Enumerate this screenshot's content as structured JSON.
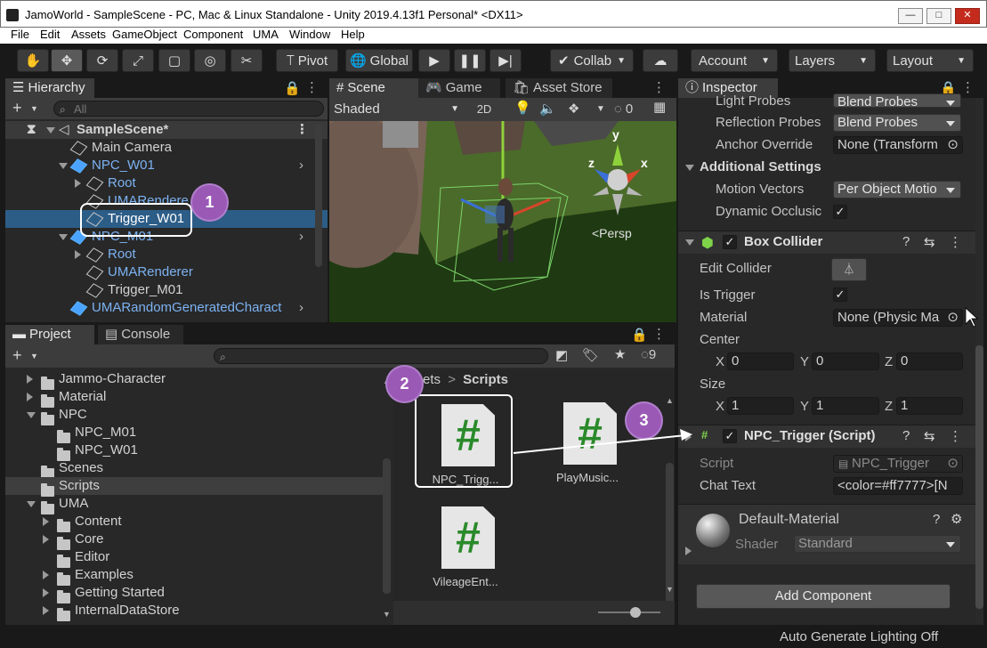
{
  "window": {
    "title": "JamoWorld - SampleScene - PC, Mac & Linux Standalone - Unity 2019.4.13f1 Personal* <DX11>",
    "controls": [
      "—",
      "□",
      "✕"
    ]
  },
  "menu": [
    "File",
    "Edit",
    "Assets",
    "GameObject",
    "Component",
    "UMA",
    "Window",
    "Help"
  ],
  "toolbar": {
    "pivot": "Pivot",
    "global": "Global",
    "collab": "Collab",
    "account": "Account",
    "layers": "Layers",
    "layout": "Layout"
  },
  "hierarchy": {
    "tab": "Hierarchy",
    "search_placeholder": "All",
    "scene": "SampleScene*",
    "items": [
      {
        "label": "Main Camera",
        "indent": 1,
        "color": "normal",
        "arrow": "none",
        "icon": "cube"
      },
      {
        "label": "NPC_W01",
        "indent": 1,
        "color": "blue",
        "arrow": "down",
        "icon": "blue-cube",
        "chevron": true
      },
      {
        "label": "Root",
        "indent": 2,
        "color": "blue",
        "arrow": "right",
        "icon": "cube"
      },
      {
        "label": "UMARendere",
        "indent": 2,
        "color": "blue",
        "arrow": "none",
        "icon": "cube"
      },
      {
        "label": "Trigger_W01",
        "indent": 2,
        "color": "normal",
        "arrow": "none",
        "icon": "cube",
        "selected": true
      },
      {
        "label": "NPC_M01",
        "indent": 1,
        "color": "blue",
        "arrow": "down",
        "icon": "blue-cube",
        "chevron": true
      },
      {
        "label": "Root",
        "indent": 2,
        "color": "blue",
        "arrow": "right",
        "icon": "cube"
      },
      {
        "label": "UMARenderer",
        "indent": 2,
        "color": "blue",
        "arrow": "none",
        "icon": "cube"
      },
      {
        "label": "Trigger_M01",
        "indent": 2,
        "color": "normal",
        "arrow": "none",
        "icon": "cube"
      },
      {
        "label": "UMARandomGeneratedCharact",
        "indent": 1,
        "color": "blue",
        "arrow": "none",
        "icon": "blue-cube",
        "chevron": true
      }
    ]
  },
  "scene": {
    "tabs": [
      "Scene",
      "Game",
      "Asset Store"
    ],
    "shading": "Shaded",
    "mode": "2D",
    "hidden_count": "0",
    "gizmo_axes": {
      "y": "y",
      "x": "x",
      "z": "z"
    },
    "persp": "<Persp"
  },
  "project": {
    "tabs": [
      "Project",
      "Console"
    ],
    "hidden_count": "9",
    "tree": [
      {
        "label": "Jammo-Character",
        "indent": 1,
        "arrow": "right"
      },
      {
        "label": "Material",
        "indent": 1,
        "arrow": "right"
      },
      {
        "label": "NPC",
        "indent": 1,
        "arrow": "down"
      },
      {
        "label": "NPC_M01",
        "indent": 2,
        "arrow": "none"
      },
      {
        "label": "NPC_W01",
        "indent": 2,
        "arrow": "none"
      },
      {
        "label": "Scenes",
        "indent": 1,
        "arrow": "none"
      },
      {
        "label": "Scripts",
        "indent": 1,
        "arrow": "none",
        "selected": true
      },
      {
        "label": "UMA",
        "indent": 1,
        "arrow": "down"
      },
      {
        "label": "Content",
        "indent": 2,
        "arrow": "right"
      },
      {
        "label": "Core",
        "indent": 2,
        "arrow": "right"
      },
      {
        "label": "Editor",
        "indent": 2,
        "arrow": "none"
      },
      {
        "label": "Examples",
        "indent": 2,
        "arrow": "right"
      },
      {
        "label": "Getting Started",
        "indent": 2,
        "arrow": "right"
      },
      {
        "label": "InternalDataStore",
        "indent": 2,
        "arrow": "right"
      }
    ],
    "breadcrumb": {
      "parent": "Assets",
      "sep": ">",
      "current": "Scripts"
    },
    "assets": [
      "NPC_Trigg...",
      "PlayMusic...",
      "VileageEnt..."
    ]
  },
  "inspector": {
    "tab": "Inspector",
    "rows": {
      "light_probes": {
        "label": "Light Probes",
        "value": "Blend Probes"
      },
      "reflection_probes": {
        "label": "Reflection Probes",
        "value": "Blend Probes"
      },
      "anchor_override": {
        "label": "Anchor Override",
        "value": "None (Transform"
      },
      "additional_settings": "Additional Settings",
      "motion_vectors": {
        "label": "Motion Vectors",
        "value": "Per Object Motio"
      },
      "dynamic_occlusion": {
        "label": "Dynamic Occlusic",
        "value": "✓"
      }
    },
    "box_collider": {
      "title": "Box Collider",
      "edit_collider": "Edit Collider",
      "is_trigger": "Is Trigger",
      "is_trigger_value": "✓",
      "material": "Material",
      "material_value": "None (Physic Ma",
      "center": "Center",
      "center_xyz": {
        "x": "0",
        "y": "0",
        "z": "0"
      },
      "size": "Size",
      "size_xyz": {
        "x": "1",
        "y": "1",
        "z": "1"
      },
      "axis_labels": {
        "x": "X",
        "y": "Y",
        "z": "Z"
      }
    },
    "npc_trigger": {
      "title": "NPC_Trigger (Script)",
      "script_label": "Script",
      "script_value": "NPC_Trigger",
      "chat_label": "Chat Text",
      "chat_value": "<color=#ff7777>[N"
    },
    "material": {
      "name": "Default-Material",
      "shader_label": "Shader",
      "shader_value": "Standard"
    },
    "add_component": "Add Component"
  },
  "status": {
    "lighting": "Auto Generate Lighting Off"
  },
  "callouts": [
    "1",
    "2",
    "3"
  ],
  "colors": {
    "accent_selection": "#2c5d87",
    "callout": "#9b59b6",
    "blue_prefab": "#7cb2f2",
    "script_green": "#2a8a2a"
  }
}
